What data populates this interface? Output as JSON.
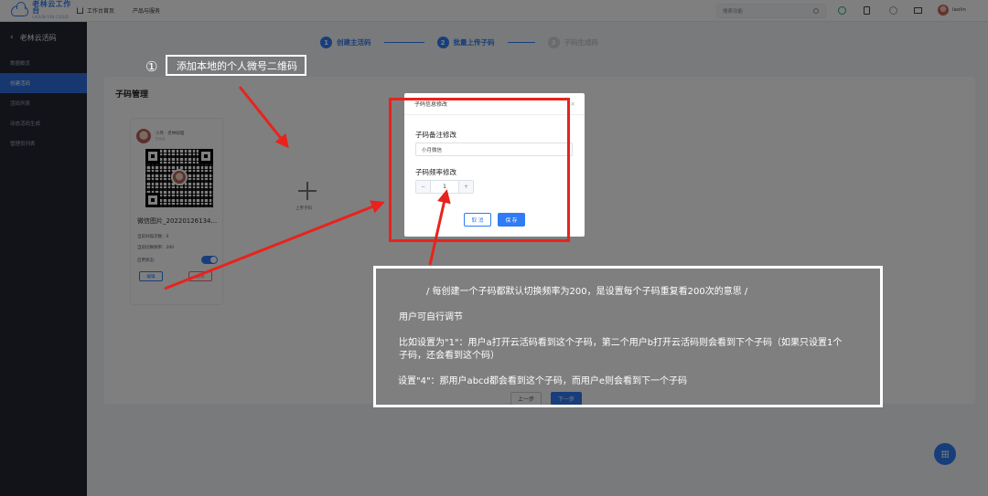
{
  "topbar": {
    "logo_main": "老林云工作台",
    "logo_sub": "LAOLIN YUN CLOUD",
    "nav": [
      "工作台首页",
      "产品与服务"
    ],
    "search_placeholder": "搜索功能",
    "user_name": "laolin"
  },
  "sidebar": {
    "title": "老林云活码",
    "items": [
      {
        "label": "数据概览",
        "active": false
      },
      {
        "label": "创建活码",
        "active": true
      },
      {
        "label": "活码列表",
        "active": false
      },
      {
        "label": "动态活码生成",
        "active": false
      },
      {
        "label": "管理员列表",
        "active": false
      }
    ]
  },
  "steps": [
    {
      "num": "1",
      "label": "创建主活码",
      "state": "active"
    },
    {
      "num": "2",
      "label": "批量上传子码",
      "state": "active"
    },
    {
      "num": "3",
      "label": "子码生成码",
      "state": "inactive"
    }
  ],
  "main": {
    "section_title": "子码管理",
    "code_card": {
      "name": "小月 · 老林助理",
      "sub": "已认证",
      "file_name": "微信图片_20220126134...",
      "stat_scans": "当前扫描次数：0",
      "stat_threshold": "当前切换频率：200",
      "status_label": "启用状态:",
      "enabled": true,
      "edit_label": "编辑",
      "delete_label": "删除"
    },
    "add_label": "上传子码",
    "prev_label": "上一步",
    "next_label": "下一步"
  },
  "modal": {
    "title": "子码信息修改",
    "remark_label": "子码备注修改",
    "remark_value": "小月微信",
    "freq_label": "子码频率修改",
    "freq_value": "1",
    "minus": "−",
    "plus": "+",
    "cancel_label": "取 消",
    "save_label": "保 存"
  },
  "annotations": {
    "circle_num": "①",
    "hint1": "添加本地的个人微号二维码",
    "note_lines": [
      "/ 每创建一个子码都默认切换频率为200，是设置每个子码重复看200次的意思 /",
      "用户可自行调节",
      "比如设置为\"1\"：用户a打开云活码看到这个子码，第二个用户b打开云活码则会看到下个子码（如果只设置1个",
      "子码，还会看到这个码）",
      "设置\"4\"：那用户abcd都会看到这个子码，而用户e则会看到下一个子码"
    ]
  },
  "colors": {
    "accent": "#2f7cf6",
    "sidebar_bg": "#222733",
    "annotation_red": "#e8231c"
  }
}
